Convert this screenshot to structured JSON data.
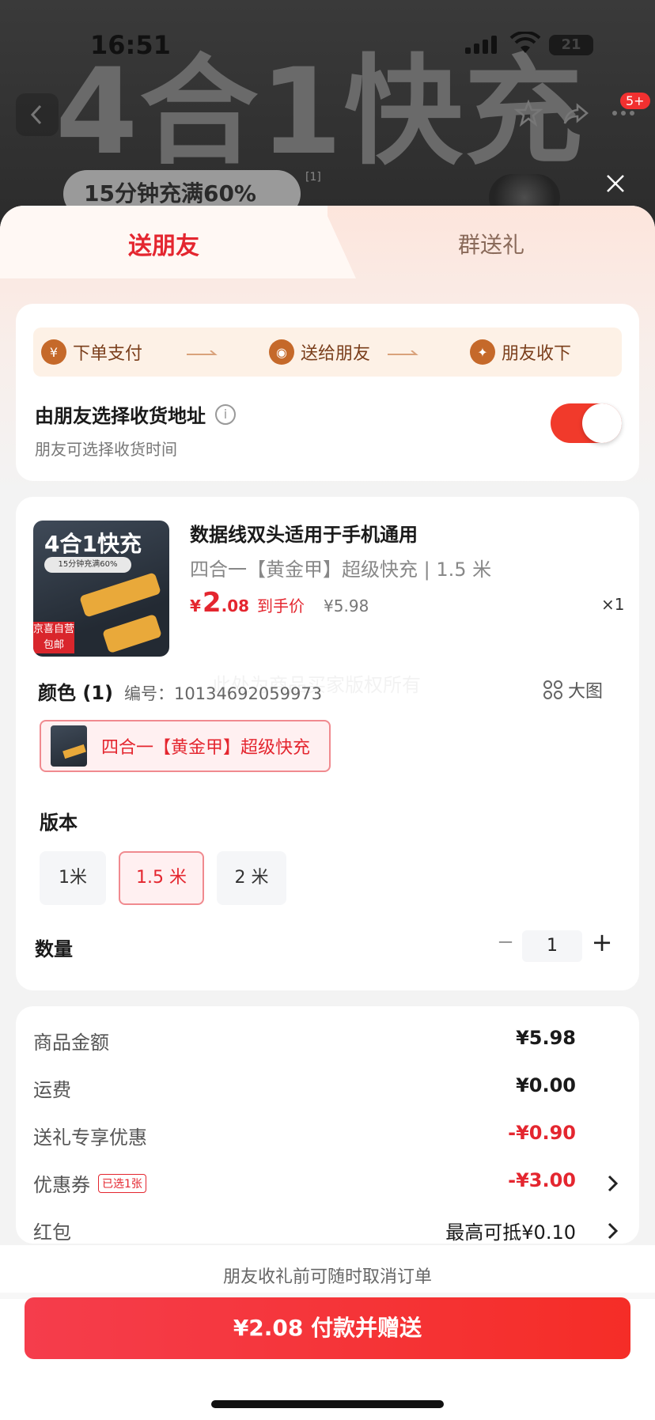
{
  "status_bar": {
    "time": "16:51",
    "battery": "21"
  },
  "background": {
    "banner_text": "4合1快充",
    "pill_text": "15分钟充满60%",
    "footnote": "[1]",
    "cart_badge": "5+"
  },
  "tabs": [
    {
      "label": "送朋友",
      "active": true
    },
    {
      "label": "群送礼",
      "active": false
    }
  ],
  "steps": [
    {
      "icon": "¥",
      "label": "下单支付"
    },
    {
      "icon": "◉",
      "label": "送给朋友"
    },
    {
      "icon": "✦",
      "label": "朋友收下"
    }
  ],
  "address": {
    "title": "由朋友选择收货地址",
    "subtitle": "朋友可选择收货时间",
    "toggle_on": true
  },
  "product": {
    "image_title": "4合1快充",
    "image_pill": "15分钟充满60%",
    "image_tag": "京喜自营 包邮",
    "title": "数据线双头适用于手机通用",
    "spec": "四合一【黄金甲】超级快充 | 1.5 米",
    "price_symbol": "¥",
    "price_int": "2",
    "price_dec": ".08",
    "price_tag": "到手价",
    "original_price": "¥5.98",
    "quantity": "×1"
  },
  "color": {
    "title": "颜色 (1)",
    "code": "编号：10134692059973",
    "big_image_label": "大图",
    "watermark": "此处为商品买家版权所有",
    "selected_option": "四合一【黄金甲】超级快充"
  },
  "version": {
    "title": "版本",
    "options": [
      "1米",
      "1.5 米",
      "2 米"
    ],
    "selected_index": 1
  },
  "qty": {
    "title": "数量",
    "value": "1",
    "minus": "−",
    "plus": "+"
  },
  "summary": [
    {
      "label": "商品金额",
      "value": "¥5.98",
      "red": false,
      "chevron": false
    },
    {
      "label": "运费",
      "value": "¥0.00",
      "red": false,
      "chevron": false
    },
    {
      "label": "送礼专享优惠",
      "value": "-¥0.90",
      "red": true,
      "chevron": false
    },
    {
      "label": "优惠券",
      "badge": "已选1张",
      "value": "-¥3.00",
      "red": true,
      "chevron": true
    },
    {
      "label": "红包",
      "value": "最高可抵¥0.10",
      "red": false,
      "chevron": true
    }
  ],
  "bottom": {
    "note": "朋友收礼前可随时取消订单",
    "pay_button": "¥2.08 付款并赠送"
  },
  "colors": {
    "brand_red": "#e4262f",
    "toggle_red": "#f13a2b",
    "step_brown": "#c5692a"
  }
}
